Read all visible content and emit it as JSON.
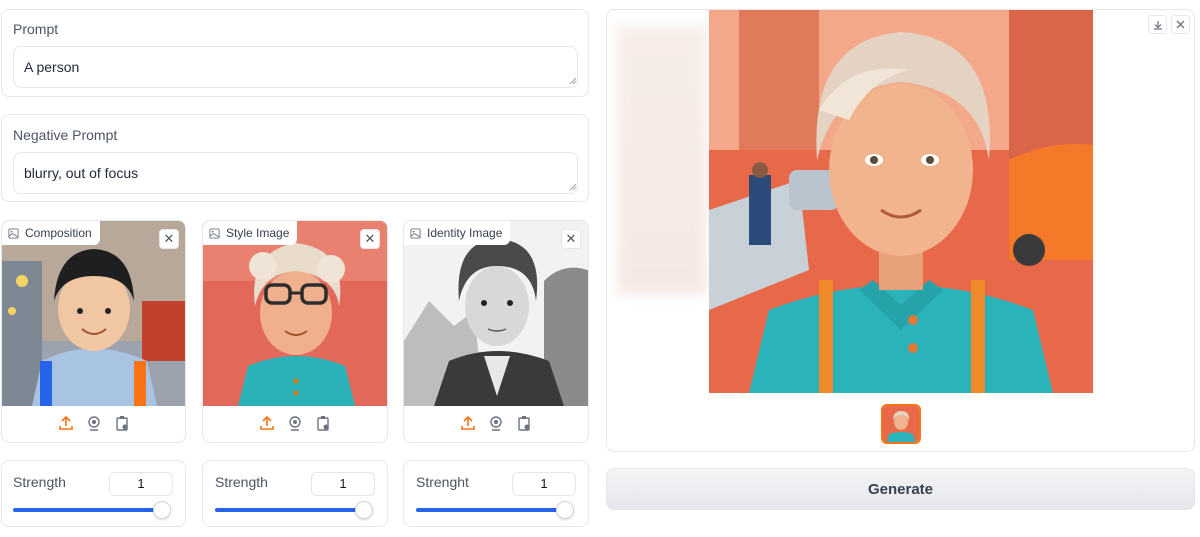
{
  "prompt": {
    "label": "Prompt",
    "value": "A person"
  },
  "negative_prompt": {
    "label": "Negative Prompt",
    "value": "blurry, out of focus"
  },
  "images": [
    {
      "tag": "Composition",
      "close": "✕",
      "strength_label": "Strength",
      "strength_value": "1",
      "strength_fraction": 1.0
    },
    {
      "tag": "Style Image",
      "close": "✕",
      "strength_label": "Strength",
      "strength_value": "1",
      "strength_fraction": 1.0
    },
    {
      "tag": "Identity Image",
      "close": "✕",
      "strength_label": "Strenght",
      "strength_value": "1",
      "strength_fraction": 1.0
    }
  ],
  "output": {
    "download_icon": "download-icon",
    "close_icon": "close-icon"
  },
  "generate_button": "Generate",
  "colors": {
    "accent": "#f97316",
    "slider": "#2563eb"
  }
}
